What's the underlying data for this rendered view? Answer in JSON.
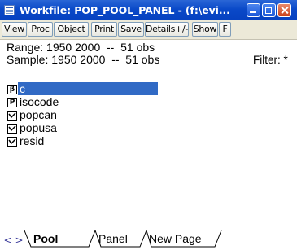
{
  "window": {
    "title": "Workfile: POP_POOL_PANEL - (f:\\evi...",
    "controls": [
      "minimize",
      "maximize",
      "close"
    ]
  },
  "toolbar": {
    "buttons": [
      "View",
      "Proc",
      "Object",
      "Print",
      "Save",
      "Details+/-",
      "Show",
      "F"
    ]
  },
  "info": {
    "range_label": "Range:",
    "range_value": "1950 2000  --  51 obs",
    "sample_label": "Sample:",
    "sample_value": "1950 2000  --  51 obs",
    "filter_label": "Filter: *"
  },
  "objects": [
    {
      "name": "c",
      "icon": "coef-vector-icon",
      "glyph": "β",
      "selected": true
    },
    {
      "name": "isocode",
      "icon": "pool-object-icon",
      "glyph": "P",
      "selected": false
    },
    {
      "name": "popcan",
      "icon": "series-icon",
      "selected": false
    },
    {
      "name": "popusa",
      "icon": "series-icon",
      "selected": false
    },
    {
      "name": "resid",
      "icon": "series-icon",
      "selected": false
    }
  ],
  "tabs": {
    "nav_prev": "<",
    "nav_next": ">",
    "items": [
      "Pool",
      "Panel",
      "New Page"
    ],
    "active": "Pool"
  }
}
